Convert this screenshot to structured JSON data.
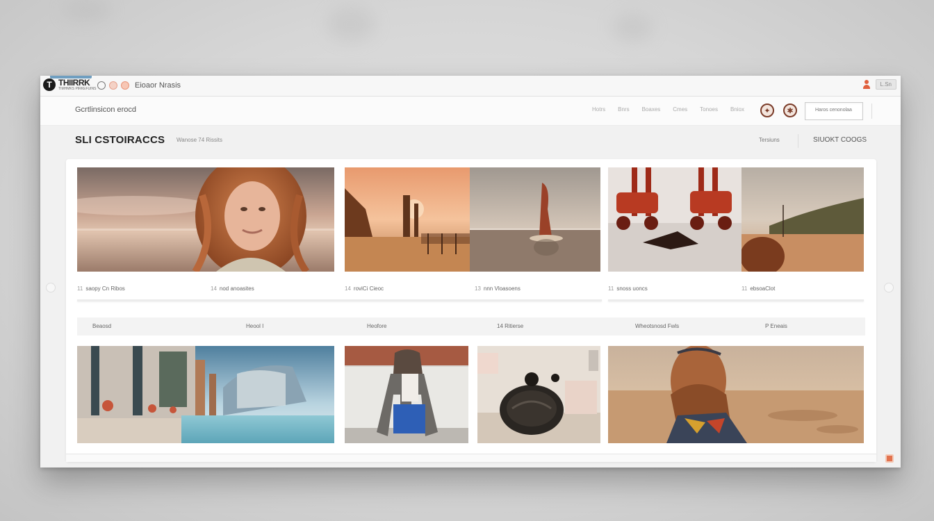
{
  "titlebar": {
    "logo_mark": "T",
    "logo_text": "THIIRRK",
    "logo_sub": "TIMHMKS PIRKEFUINS",
    "app_title": "Eioaor Nrasis",
    "action_label": "L.Sn"
  },
  "nav": {
    "left_text": "Gcrtlinsicon erocd",
    "links": [
      "Hotrs",
      "Bnrs",
      "Boaxes",
      "Cmes",
      "Tonoes",
      "Bniox"
    ],
    "search_placeholder": "Haros cenonolaa"
  },
  "header": {
    "title": "SLI CSTOIRACCS",
    "subtitle": "Wanose 74 Rissits",
    "right_a": "Tersiuns",
    "right_b": "SIUOKT COOGS"
  },
  "gallery": {
    "row1_captions": [
      {
        "num": "11",
        "text": "saopy Cn Ribos"
      },
      {
        "num": "14",
        "text": "nod anoasites"
      },
      {
        "num": "14",
        "text": "roviCi Cieoc"
      },
      {
        "num": "13",
        "text": "nnn Vloasoens"
      },
      {
        "num": "11",
        "text": "snoss uoncs"
      },
      {
        "num": "11",
        "text": "ebsoaClot"
      }
    ],
    "strip_labels": [
      "Beaosd",
      "Heool I",
      "Heofore",
      "14 Ritierse",
      "Wheotsnosd Fwls",
      "P Eneais"
    ]
  },
  "colors": {
    "accent_blue": "#6f9ec0",
    "accent_orange": "#e0603e",
    "icon_brown": "#7a3b28"
  },
  "icons": [
    "logo-icon",
    "circle-icon",
    "user-icon",
    "compass-icon",
    "badge-icon",
    "corner-icon"
  ]
}
